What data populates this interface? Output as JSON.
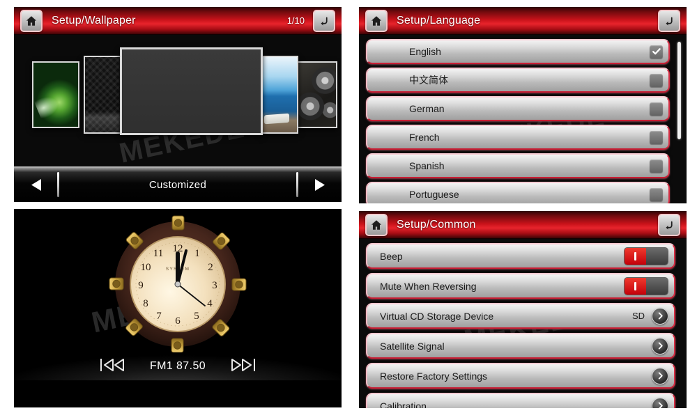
{
  "panels": {
    "wallpaper": {
      "home_icon": "home-icon",
      "title": "Setup/Wallpaper",
      "page_indicator": "1/10",
      "back_icon": "back-arrow-icon",
      "nav": {
        "prev_icon": "triangle-left-icon",
        "label": "Customized",
        "next_icon": "triangle-right-icon"
      },
      "thumbnails": [
        {
          "name": "green-leaf-wallpaper"
        },
        {
          "name": "dark-pattern-wallpaper"
        },
        {
          "name": "dark-plain-wallpaper-selected"
        },
        {
          "name": "sea-beach-wallpaper"
        },
        {
          "name": "metal-gears-wallpaper"
        }
      ]
    },
    "language": {
      "home_icon": "home-icon",
      "title": "Setup/Language",
      "back_icon": "back-arrow-icon",
      "items": [
        {
          "label": "English",
          "checked": true
        },
        {
          "label": "中文简体",
          "checked": false
        },
        {
          "label": "German",
          "checked": false
        },
        {
          "label": "French",
          "checked": false
        },
        {
          "label": "Spanish",
          "checked": false
        },
        {
          "label": "Portuguese",
          "checked": false
        }
      ]
    },
    "clock": {
      "brand_text": "SYSTEM",
      "hour_numbers": [
        "12",
        "1",
        "2",
        "3",
        "4",
        "5",
        "6",
        "7",
        "8",
        "9",
        "10",
        "11"
      ],
      "time": {
        "hour": 12,
        "minute": 2,
        "second": 22
      },
      "radio": {
        "prev_icon": "previous-track-icon",
        "station": "FM1 87.50",
        "next_icon": "next-track-icon"
      }
    },
    "common": {
      "home_icon": "home-icon",
      "title": "Setup/Common",
      "back_icon": "back-arrow-icon",
      "items": [
        {
          "label": "Beep",
          "control": "toggle",
          "state": "on"
        },
        {
          "label": "Mute When Reversing",
          "control": "toggle",
          "state": "on"
        },
        {
          "label": "Virtual CD Storage Device",
          "control": "value-chevron",
          "value": "SD"
        },
        {
          "label": "Satellite Signal",
          "control": "chevron",
          "value": ""
        },
        {
          "label": "Restore Factory Settings",
          "control": "chevron",
          "value": ""
        },
        {
          "label": "Calibration",
          "control": "chevron",
          "value": ""
        }
      ]
    }
  },
  "watermark": {
    "text": "MEKEDE"
  },
  "colors": {
    "header_red": "#c8121a",
    "toggle_on": "#d4000a",
    "row_border": "#d62f45",
    "panel_bg": "#000000"
  }
}
